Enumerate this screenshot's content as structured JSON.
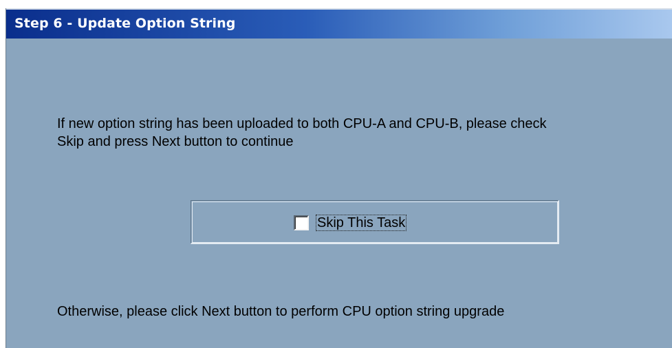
{
  "window": {
    "title": "Step 6 - Update Option String"
  },
  "content": {
    "instruction_line1": "If new option string has been uploaded to both CPU-A and CPU-B, please check",
    "instruction_line2": "Skip and press Next button to continue",
    "skip_checkbox": {
      "label": "Skip This Task",
      "checked": false
    },
    "otherwise_text": "Otherwise, please click Next button to perform CPU option string upgrade"
  },
  "colors": {
    "panel_background": "#8aa5be",
    "title_gradient_start": "#0a2e8c",
    "title_gradient_end": "#a9c8ee",
    "title_text": "#ffffff"
  }
}
